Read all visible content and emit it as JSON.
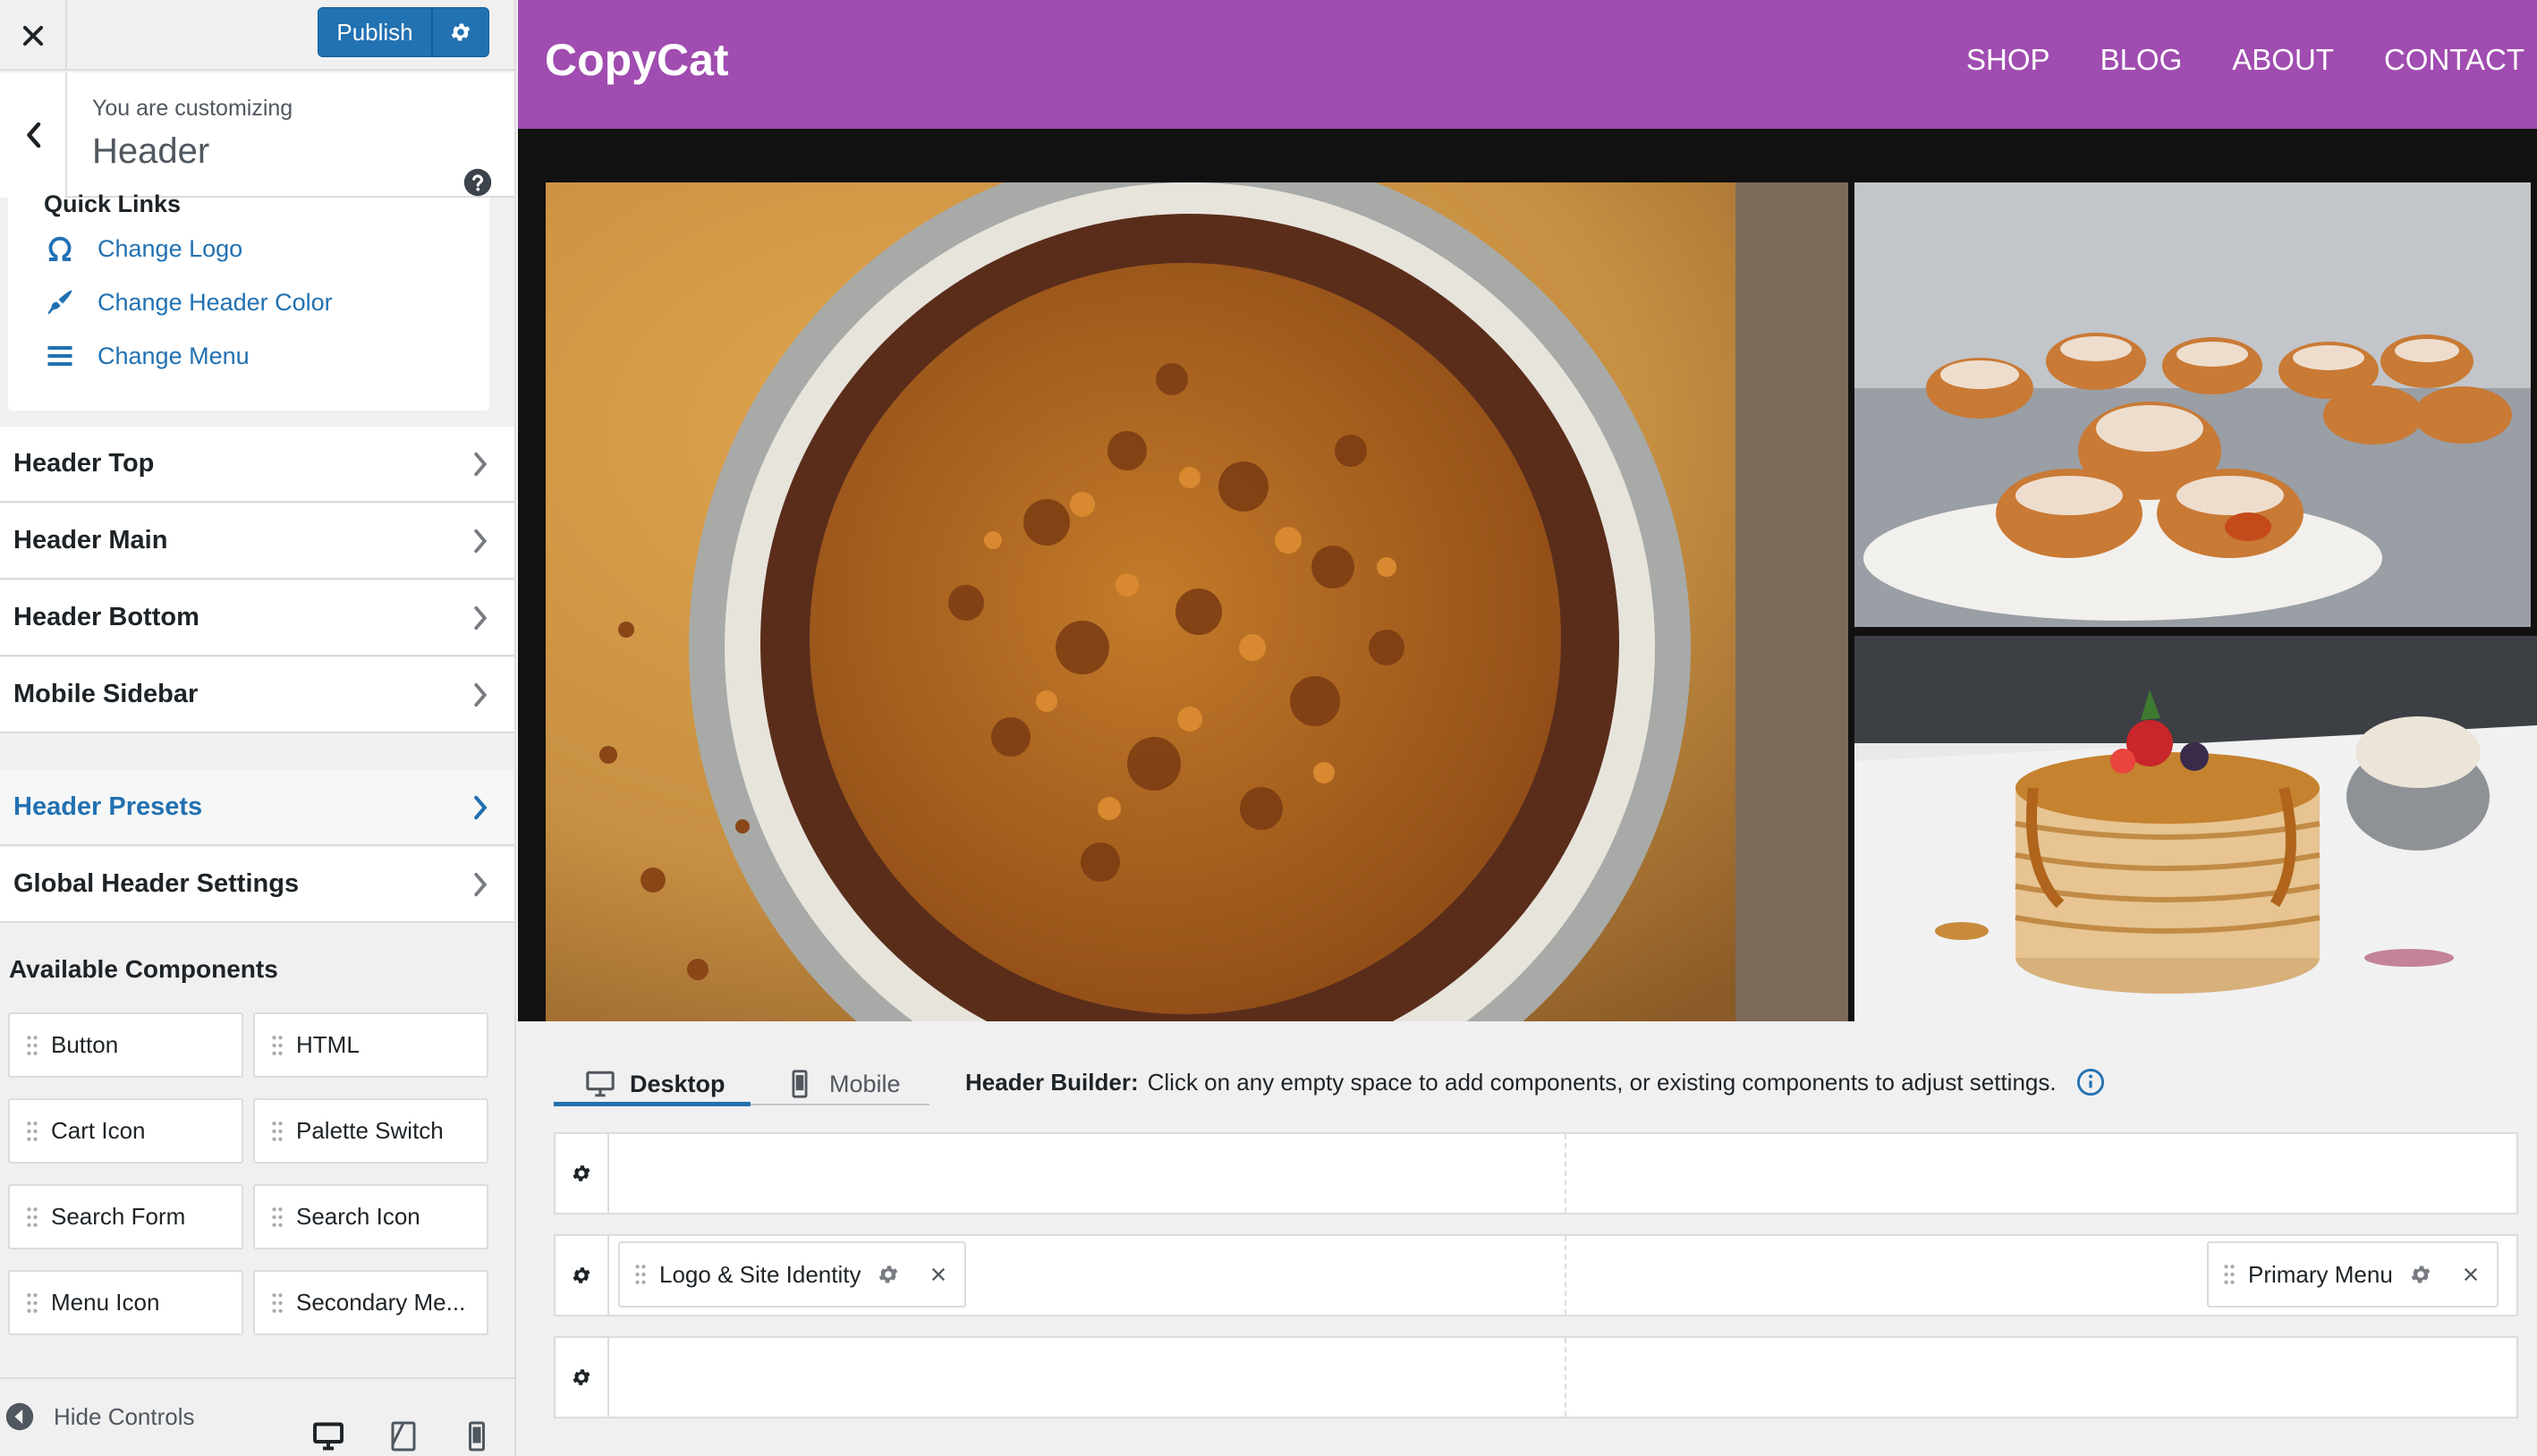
{
  "sidebar": {
    "publish_label": "Publish",
    "customizing_label": "You are customizing",
    "customizing_title": "Header",
    "quick_links": {
      "title": "Quick Links",
      "items": [
        {
          "label": "Change Logo",
          "icon": "omega-icon"
        },
        {
          "label": "Change Header Color",
          "icon": "paint-brush-icon"
        },
        {
          "label": "Change Menu",
          "icon": "menu-icon"
        }
      ]
    },
    "sections": [
      {
        "label": "Header Top"
      },
      {
        "label": "Header Main"
      },
      {
        "label": "Header Bottom"
      },
      {
        "label": "Mobile Sidebar"
      },
      {
        "label": "Header Presets"
      },
      {
        "label": "Global Header Settings"
      }
    ],
    "available_components_title": "Available Components",
    "components": [
      "Button",
      "HTML",
      "Cart Icon",
      "Palette Switch",
      "Search Form",
      "Search Icon",
      "Menu Icon",
      "Secondary Me..."
    ],
    "hide_controls": "Hide Controls"
  },
  "preview": {
    "site_title": "CopyCat",
    "nav": [
      "SHOP",
      "BLOG",
      "ABOUT",
      "CONTACT"
    ],
    "header_color": "#a04cb0"
  },
  "builder": {
    "tabs": [
      "Desktop",
      "Mobile"
    ],
    "info_label": "Header Builder:",
    "info_text": "Click on any empty space to add components, or existing components to adjust settings.",
    "placed": {
      "logo": "Logo & Site Identity",
      "menu": "Primary Menu"
    }
  },
  "colors": {
    "accent": "#2271b1",
    "sidebar_bg": "#f0f0f1"
  }
}
